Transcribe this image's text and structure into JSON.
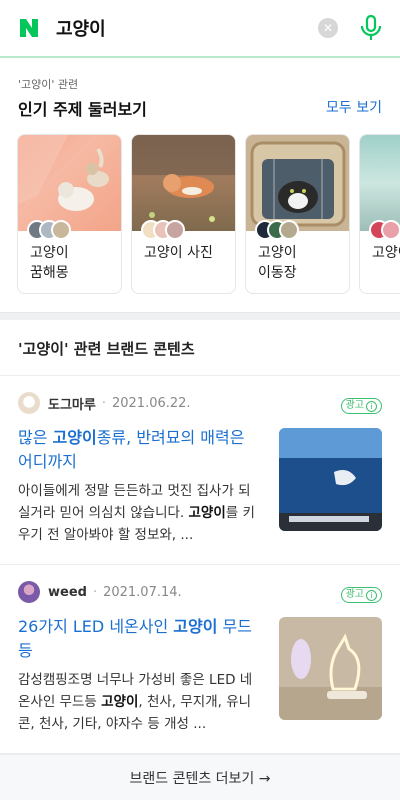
{
  "search": {
    "query": "고양이",
    "logo_letter": "N",
    "clear_icon": "close-icon",
    "mic_icon": "microphone-icon"
  },
  "topics": {
    "context": "'고양이' 관련",
    "title": "인기 주제 둘러보기",
    "more": "모두 보기",
    "cards": [
      {
        "label": "고양이 꿈해몽"
      },
      {
        "label": "고양이 사진"
      },
      {
        "label": "고양이 이동장"
      },
      {
        "label": "고양이 실"
      }
    ]
  },
  "brand": {
    "heading": "'고양이' 관련 브랜드 콘텐츠",
    "ad_label": "광고",
    "posts": [
      {
        "author": "도그마루",
        "date": "2021.06.22.",
        "title_pre": "많은 ",
        "title_bold": "고양이",
        "title_post": "종류, 반려묘의 매력은 어디까지",
        "desc_pre": "아이들에게 정말 든든하고 멋진 집사가 되실거라 믿어 의심치 않습니다. ",
        "desc_bold": "고양이",
        "desc_post": "를 키우기 전 알아봐야 할 정보와, ..."
      },
      {
        "author": "weed",
        "date": "2021.07.14.",
        "title_pre": "26가지 LED 네온사인 ",
        "title_bold": "고양이",
        "title_post": " 무드등",
        "desc_pre": "감성캠핑조명 너무나 가성비 좋은 LED 네온사인 무드등 ",
        "desc_bold": "고양이",
        "desc_post": ", 천사, 무지개, 유니콘, 천사, 기타, 야자수 등 개성 ..."
      }
    ],
    "more": "브랜드 콘텐츠 더보기 →"
  },
  "colors": {
    "brand_green": "#03c75a",
    "link_blue": "#1b6fd1",
    "ad_green": "#3cbf6f"
  }
}
